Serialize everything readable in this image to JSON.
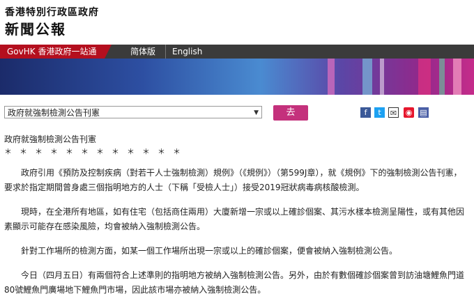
{
  "header": {
    "gov_name": "香港特別行政區政府",
    "paper_name": "新聞公報"
  },
  "topnav": {
    "gov_link": "GovHK 香港政府一站通",
    "lang_sc": "简体版",
    "lang_en": "English"
  },
  "selector": {
    "selected": "政府就強制檢測公告刊憲",
    "go_label": "去"
  },
  "share_icons": [
    "facebook-icon",
    "twitter-icon",
    "email-icon",
    "weibo-icon",
    "print-icon"
  ],
  "article": {
    "title": "政府就強制檢測公告刊憲",
    "stars": "＊　＊　＊　＊　＊　＊　＊　＊　＊　＊　＊　＊",
    "p1": "　　政府引用《預防及控制疾病（對若干人士強制檢測）規例》（《規例》）（第599J章），就《規例》下的強制檢測公告刊憲，要求於指定期間曾身處三個指明地方的人士（下稱「受檢人士」）接受2019冠狀病毒病核酸檢測。",
    "p2": "　　現時，在全港所有地區，如有住宅（包括商住兩用）大廈新增一宗或以上確診個案、其污水樣本檢測呈陽性，或有其他因素顯示可能存在感染風險，均會被納入強制檢測公告。",
    "p3": "　　針對工作場所的檢測方面，如某一個工作場所出現一宗或以上的確診個案，便會被納入強制檢測公告。",
    "p4": "　　今日（四月五日）有兩個符合上述準則的指明地方被納入強制檢測公告。另外，由於有數個確診個案曾到訪油塘鯉魚門道80號鯉魚門廣場地下鯉魚門市場，因此該市場亦被納入強制檢測公告。"
  },
  "colors": {
    "gov_red": "#b40f1e",
    "go_button": "#c4317c",
    "nav_dark": "#3b3b3b"
  }
}
